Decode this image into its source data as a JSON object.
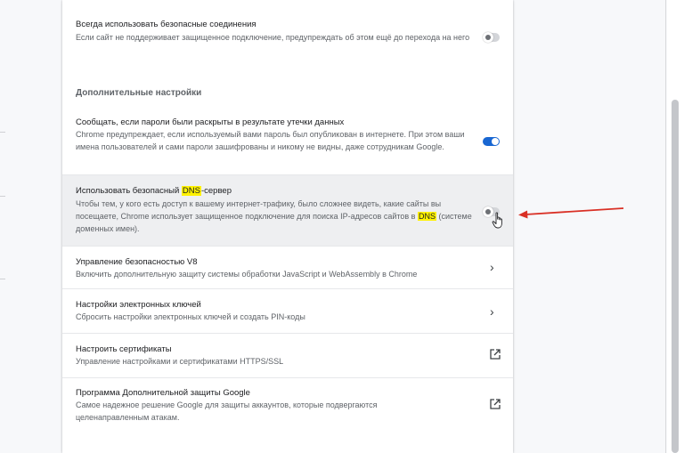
{
  "settings": {
    "secure_connections": {
      "title": "Всегда использовать безопасные соединения",
      "desc": "Если сайт не поддерживает защищенное подключение, предупреждать об этом ещё до перехода на него",
      "enabled": false
    },
    "section_title": "Дополнительные настройки",
    "password_leak": {
      "title": "Сообщать, если пароли были раскрыты в результате утечки данных",
      "desc": "Chrome предупреждает, если используемый вами пароль был опубликован в интернете. При этом ваши имена пользователей и сами пароли зашифрованы и никому не видны, даже сотрудникам Google.",
      "enabled": true
    },
    "secure_dns": {
      "title_prefix": "Использовать безопасный ",
      "title_highlight": "DNS",
      "title_suffix": "-сервер",
      "desc_prefix": "Чтобы тем, у кого есть доступ к вашему интернет-трафику, было сложнее видеть, какие сайты вы посещаете, Chrome использует защищенное подключение для поиска IP-адресов сайтов в ",
      "desc_highlight": "DNS",
      "desc_suffix": " (системе доменных имен).",
      "enabled": false
    },
    "v8_security": {
      "title": "Управление безопасностью V8",
      "desc": "Включить дополнительную защиту системы обработки JavaScript и WebAssembly в Chrome"
    },
    "security_keys": {
      "title": "Настройки электронных ключей",
      "desc": "Сбросить настройки электронных ключей и создать PIN-коды"
    },
    "certificates": {
      "title": "Настроить сертификаты",
      "desc": "Управление настройками и сертификатами HTTPS/SSL"
    },
    "advanced_protection": {
      "title": "Программа Дополнительной защиты Google",
      "desc": "Самое надежное решение Google для защиты аккаунтов, которые подвергаются целенаправленным атакам."
    }
  },
  "icons": {
    "chevron": "chevron-right-icon",
    "external": "open-in-new-icon",
    "pointer": "hand-cursor-icon",
    "annotation": "red-arrow"
  },
  "colors": {
    "toggle_on": "#1967d2",
    "highlight": "#fff200",
    "annotation_arrow": "#d93025"
  }
}
